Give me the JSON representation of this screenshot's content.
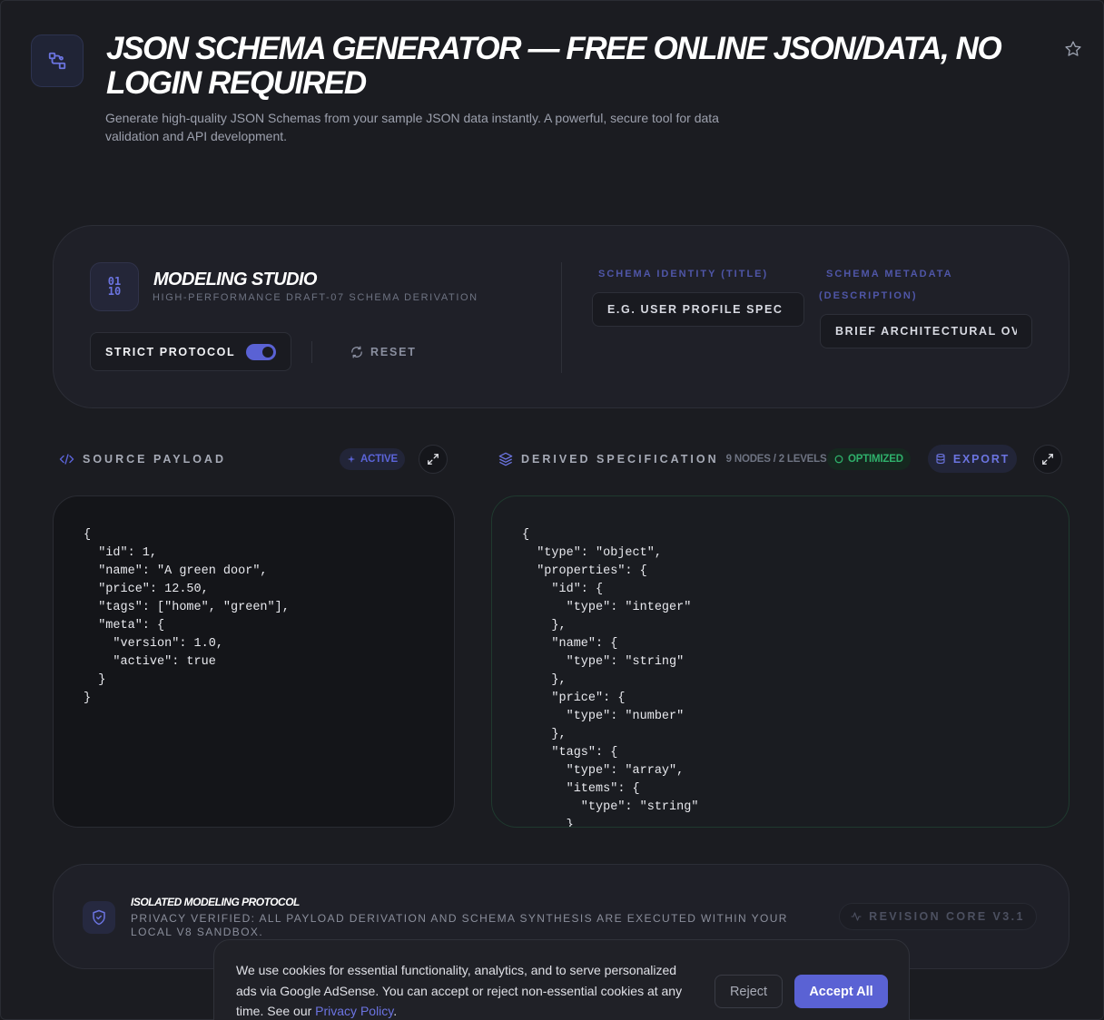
{
  "header": {
    "title": "JSON Schema Generator — Free Online JSON/Data, No Login Required",
    "subtitle": "Generate high-quality JSON Schemas from your sample JSON data instantly. A powerful, secure tool for data validation and API development."
  },
  "studio": {
    "icon_top": "01",
    "icon_bottom": "10",
    "title": "Modeling Studio",
    "subtitle": "High-Performance Draft-07 Schema Derivation",
    "strict_label": "Strict Protocol",
    "strict_enabled": true,
    "reset_label": "Reset",
    "identity_label": "Schema Identity (Title)",
    "identity_placeholder": "E.G. USER PROFILE SPEC",
    "metadata_label": "Schema Metadata (Description)",
    "metadata_placeholder": "BRIEF ARCHITECTURAL OVERVIEW"
  },
  "source": {
    "title": "Source Payload",
    "status": "Active",
    "code": "{\n  \"id\": 1,\n  \"name\": \"A green door\",\n  \"price\": 12.50,\n  \"tags\": [\"home\", \"green\"],\n  \"meta\": {\n    \"version\": 1.0,\n    \"active\": true\n  }\n}"
  },
  "derived": {
    "title": "Derived Specification",
    "stats": "9 Nodes / 2 Levels",
    "status": "Optimized",
    "export_label": "Export",
    "code": "{\n  \"type\": \"object\",\n  \"properties\": {\n    \"id\": {\n      \"type\": \"integer\"\n    },\n    \"name\": {\n      \"type\": \"string\"\n    },\n    \"price\": {\n      \"type\": \"number\"\n    },\n    \"tags\": {\n      \"type\": \"array\",\n      \"items\": {\n        \"type\": \"string\"\n      }\n    }"
  },
  "protocol": {
    "title": "Isolated Modeling Protocol",
    "text": "Privacy Verified: All payload derivation and schema synthesis are executed within your local V8 sandbox.",
    "revision": "Revision Core v3.1"
  },
  "cookie": {
    "text": "We use cookies for essential functionality, analytics, and to serve personalized ads via Google AdSense. You can accept or reject non-essential cookies at any time. See our",
    "link": "Privacy Policy",
    "period": ".",
    "reject_label": "Reject",
    "accept_label": "Accept All"
  },
  "colors": {
    "accent": "#5a62d4",
    "success": "#2fb06b",
    "background": "#1b1c21"
  }
}
